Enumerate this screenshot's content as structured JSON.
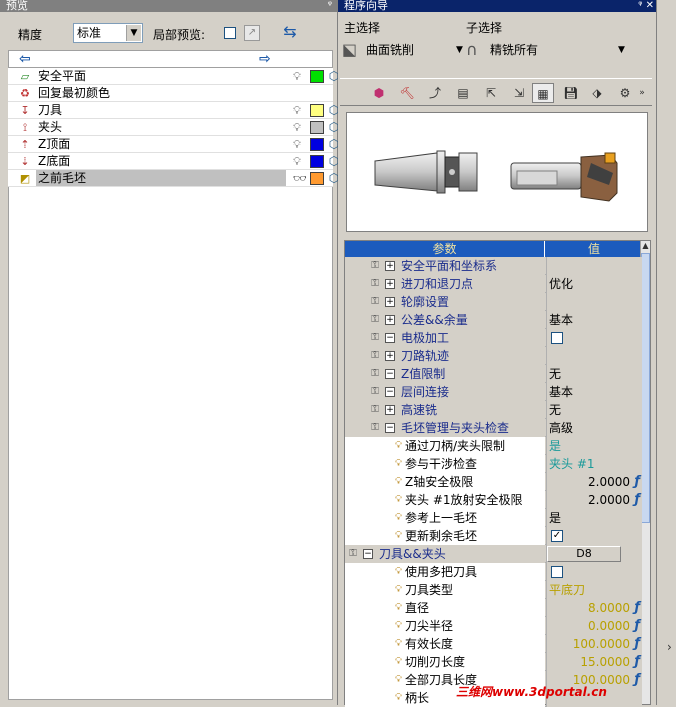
{
  "left_panel": {
    "title": "预览",
    "pin": "ᵠ",
    "precision_label": "精度",
    "precision_value": "标准",
    "local_preview_label": "局部预览:",
    "items": [
      {
        "icon": "safe-plane-icon",
        "glyph": "▱",
        "label": "安全平面",
        "color": "#00e000",
        "selected": false
      },
      {
        "icon": "restore-color-icon",
        "glyph": "♻",
        "label": "回复最初颜色",
        "color": "",
        "selected": false
      },
      {
        "icon": "tool-icon",
        "glyph": "↧",
        "label": "刀具",
        "color": "#ffff80",
        "selected": false
      },
      {
        "icon": "holder-icon",
        "glyph": "⟟",
        "label": "夹头",
        "color": "#c0c0c0",
        "selected": false
      },
      {
        "icon": "z-top-icon",
        "glyph": "⇡",
        "label": "Z顶面",
        "color": "#0000e0",
        "selected": false
      },
      {
        "icon": "z-bottom-icon",
        "glyph": "⇣",
        "label": "Z底面",
        "color": "#0000e0",
        "selected": false
      },
      {
        "icon": "previous-stock-icon",
        "glyph": "◩",
        "label": "之前毛坯",
        "color": "#ff9a30",
        "selected": true
      }
    ]
  },
  "right_panel": {
    "title": "程序向导",
    "title_buttons": "ᵠ ✕",
    "main_select_label": "主选择",
    "sub_select_label": "子选择",
    "main_select_value": "曲面铣削",
    "sub_select_value": "精铣所有",
    "grid_header_param": "参数",
    "grid_header_value": "值",
    "rows": [
      {
        "indent": 1,
        "kind": "group",
        "expander": "+",
        "name": "安全平面和坐标系",
        "value": "",
        "vclass": ""
      },
      {
        "indent": 1,
        "kind": "group",
        "expander": "+",
        "name": "进刀和退刀点",
        "value": "优化",
        "vclass": ""
      },
      {
        "indent": 1,
        "kind": "group",
        "expander": "+",
        "name": "轮廓设置",
        "value": "",
        "vclass": ""
      },
      {
        "indent": 1,
        "kind": "group",
        "expander": "+",
        "name": "公差&&余量",
        "value": "基本",
        "vclass": ""
      },
      {
        "indent": 1,
        "kind": "group",
        "expander": "−",
        "name": "电极加工",
        "value": "",
        "vclass": "check-empty"
      },
      {
        "indent": 1,
        "kind": "group",
        "expander": "+",
        "name": "刀路轨迹",
        "value": "",
        "vclass": ""
      },
      {
        "indent": 1,
        "kind": "group",
        "expander": "−",
        "name": "Z值限制",
        "value": "无",
        "vclass": ""
      },
      {
        "indent": 1,
        "kind": "group",
        "expander": "−",
        "name": "层间连接",
        "value": "基本",
        "vclass": ""
      },
      {
        "indent": 1,
        "kind": "group",
        "expander": "+",
        "name": "高速铣",
        "value": "无",
        "vclass": ""
      },
      {
        "indent": 1,
        "kind": "group",
        "expander": "−",
        "name": "毛坯管理与夹头检查",
        "value": "高级",
        "vclass": ""
      },
      {
        "indent": 2,
        "kind": "param",
        "name": "通过刀柄/夹头限制",
        "value": "是",
        "vclass": "blue"
      },
      {
        "indent": 2,
        "kind": "param",
        "name": "参与干涉检查",
        "value": "夹头 #1",
        "vclass": "blue"
      },
      {
        "indent": 2,
        "kind": "param",
        "name": "Z轴安全极限",
        "value": "2.0000",
        "vclass": "num",
        "f": "ƒ"
      },
      {
        "indent": 2,
        "kind": "param",
        "name": "夹头 #1放射安全极限",
        "value": "2.0000",
        "vclass": "num",
        "f": "ƒ"
      },
      {
        "indent": 2,
        "kind": "param",
        "name": "参考上一毛坯",
        "value": "是",
        "vclass": ""
      },
      {
        "indent": 2,
        "kind": "param",
        "name": "更新剩余毛坯",
        "value": "✓",
        "vclass": "check"
      },
      {
        "indent": 0,
        "kind": "group",
        "expander": "−",
        "name": "刀具&&夹头",
        "value": "D8",
        "vclass": "button"
      },
      {
        "indent": 2,
        "kind": "param",
        "name": "使用多把刀具",
        "value": "",
        "vclass": "check-empty"
      },
      {
        "indent": 2,
        "kind": "param",
        "name": "刀具类型",
        "value": "平底刀",
        "vclass": "yellow"
      },
      {
        "indent": 2,
        "kind": "param",
        "name": "直径",
        "value": "8.0000",
        "vclass": "num yellow",
        "f": "ƒ"
      },
      {
        "indent": 2,
        "kind": "param",
        "name": "刀尖半径",
        "value": "0.0000",
        "vclass": "num yellow",
        "f": "ƒ"
      },
      {
        "indent": 2,
        "kind": "param",
        "name": "有效长度",
        "value": "100.0000",
        "vclass": "num yellow",
        "f": "ƒ"
      },
      {
        "indent": 2,
        "kind": "param",
        "name": "切削刃长度",
        "value": "15.0000",
        "vclass": "num yellow",
        "f": "ƒ"
      },
      {
        "indent": 2,
        "kind": "param",
        "name": "全部刀具长度",
        "value": "100.0000",
        "vclass": "num yellow",
        "f": "ƒ"
      },
      {
        "indent": 2,
        "kind": "param",
        "name": "柄长",
        "value": "",
        "vclass": ""
      }
    ]
  },
  "watermark": "三维网www.3dportal.cn"
}
